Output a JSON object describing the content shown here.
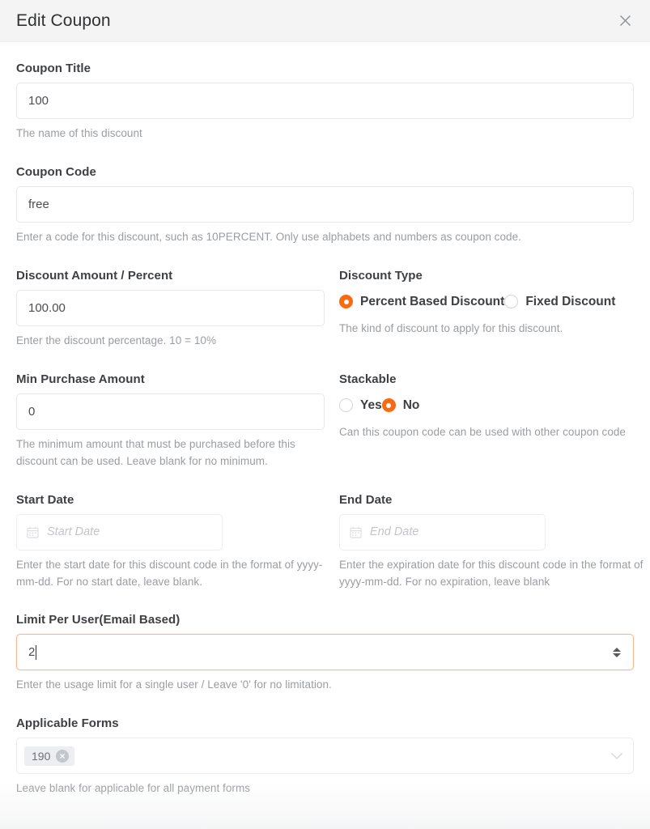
{
  "header": {
    "title": "Edit Coupon",
    "close_icon": "close-icon"
  },
  "fields": {
    "coupon_title": {
      "label": "Coupon Title",
      "value": "100",
      "help": "The name of this discount"
    },
    "coupon_code": {
      "label": "Coupon Code",
      "value": "free",
      "help": "Enter a code for this discount, such as 10PERCENT. Only use alphabets and numbers as coupon code."
    },
    "discount_amount": {
      "label": "Discount Amount / Percent",
      "value": "100.00",
      "help": "Enter the discount percentage. 10 = 10%"
    },
    "discount_type": {
      "label": "Discount Type",
      "options": [
        {
          "label": "Percent Based Discount",
          "selected": true
        },
        {
          "label": "Fixed Discount",
          "selected": false
        }
      ],
      "help": "The kind of discount to apply for this discount."
    },
    "min_purchase": {
      "label": "Min Purchase Amount",
      "value": "0",
      "help": "The minimum amount that must be purchased before this discount can be used. Leave blank for no minimum."
    },
    "stackable": {
      "label": "Stackable",
      "options": [
        {
          "label": "Yes",
          "selected": false
        },
        {
          "label": "No",
          "selected": true
        }
      ],
      "help": "Can this coupon code can be used with other coupon code"
    },
    "start_date": {
      "label": "Start Date",
      "value": "",
      "placeholder": "Start Date",
      "icon": "calendar-icon",
      "help": "Enter the start date for this discount code in the format of yyyy-mm-dd. For no start date, leave blank."
    },
    "end_date": {
      "label": "End Date",
      "value": "",
      "placeholder": "End Date",
      "icon": "calendar-icon",
      "help": "Enter the expiration date for this discount code in the format of yyyy-mm-dd. For no expiration, leave blank"
    },
    "limit_per_user": {
      "label": "Limit Per User(Email Based)",
      "value": "2",
      "focused": true,
      "help": "Enter the usage limit for a single user / Leave '0' for no limitation."
    },
    "applicable_forms": {
      "label": "Applicable Forms",
      "tags": [
        "190"
      ],
      "chevron_icon": "chevron-down-icon",
      "help": "Leave blank for applicable for all payment forms"
    }
  },
  "colors": {
    "accent": "#f96a11",
    "header_bg": "#f4f4f5",
    "border": "#e6e7e9",
    "help_text": "#9a9da1",
    "label_text": "#3d3f42"
  }
}
